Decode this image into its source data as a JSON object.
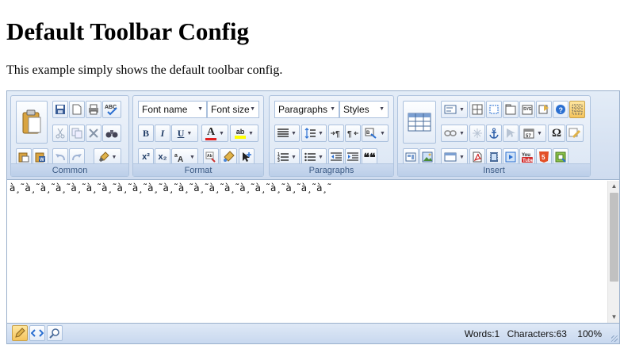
{
  "page": {
    "title": "Default Toolbar Config",
    "description": "This example simply shows the default toolbar config."
  },
  "toolbar": {
    "groups": {
      "common": "Common",
      "format": "Format",
      "paragraphs": "Paragraphs",
      "insert": "Insert"
    },
    "font_name": "Font name",
    "font_size": "Font size",
    "paragraph_style": "Paragraphs",
    "styles": "Styles",
    "bold": "B",
    "italic": "I",
    "underline": "U",
    "superscript": "x²",
    "subscript": "x₂",
    "font_color": "A",
    "highlight": "ab",
    "quote": "❝❝"
  },
  "content": {
    "text": "à¸˜à¸˜à¸˜à¸˜à¸˜à¸˜à¸˜à¸˜à¸˜à¸˜à¸˜à¸˜à¸˜à¸˜à¸˜à¸˜à¸˜à¸˜à¸˜à¸˜à¸˜"
  },
  "statusbar": {
    "words": "Words:1",
    "characters": "Characters:63",
    "zoom": "100%"
  },
  "colors": {
    "accent": "#3b5a84",
    "font_color_bar": "#e02020",
    "highlight_bar": "#ffff00"
  }
}
